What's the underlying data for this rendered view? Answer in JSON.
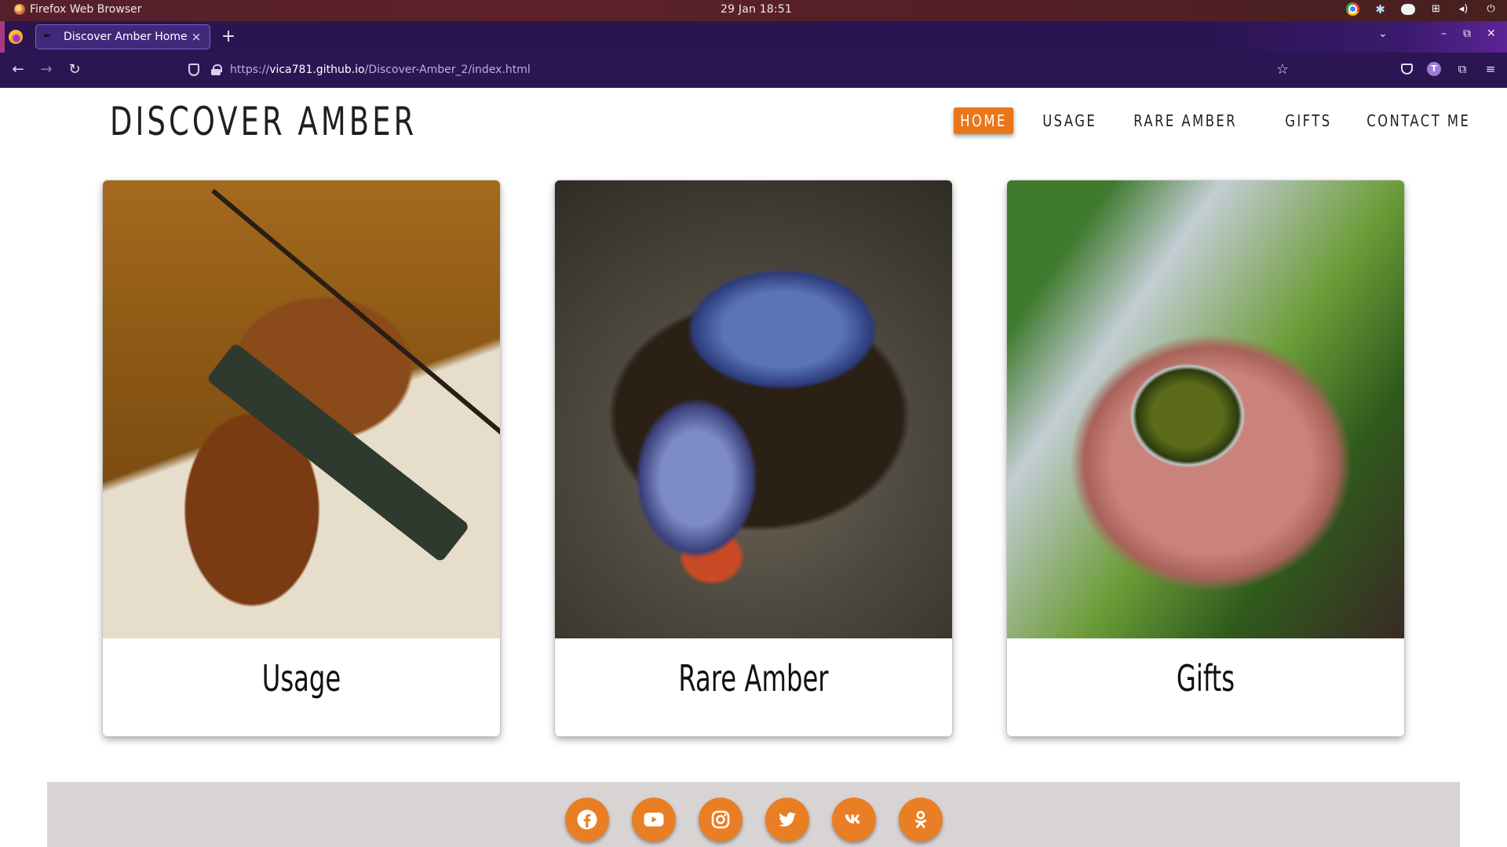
{
  "os": {
    "app_name": "Firefox Web Browser",
    "clock": "29 Jan  18:51"
  },
  "browser": {
    "tab_title": "Discover Amber Home",
    "tab_close": "×",
    "new_tab": "+",
    "url_prefix": "https://",
    "url_host": "vica781.github.io",
    "url_path": "/Discover-Amber_2/index.html"
  },
  "site": {
    "title": "DISCOVER AMBER",
    "nav": [
      {
        "label": "HOME",
        "active": true
      },
      {
        "label": "USAGE",
        "active": false
      },
      {
        "label": "RARE AMBER",
        "active": false
      },
      {
        "label": "GIFTS",
        "active": false
      },
      {
        "label": "CONTACT ME",
        "active": false
      }
    ],
    "cards": [
      {
        "caption": "Usage"
      },
      {
        "caption": "Rare Amber"
      },
      {
        "caption": "Gifts"
      }
    ],
    "social": [
      "facebook-icon",
      "youtube-icon",
      "instagram-icon",
      "twitter-icon",
      "vk-icon",
      "odnoklassniki-icon"
    ],
    "accent_color": "#e8761a",
    "footer_color": "#d8d4d3"
  }
}
